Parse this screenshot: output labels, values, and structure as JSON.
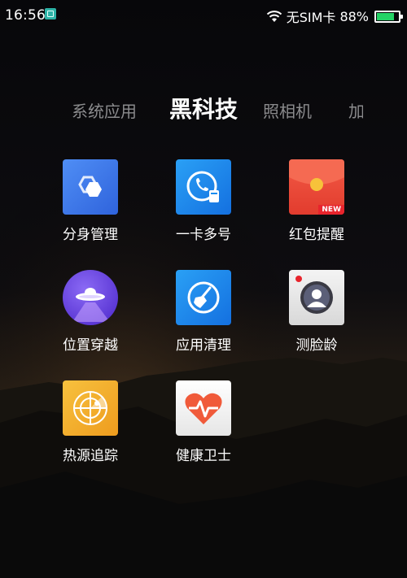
{
  "status_bar": {
    "time": "16:56",
    "carrier": "无SIM卡",
    "battery_percent": "88%",
    "battery_level": 0.88
  },
  "tabs": [
    {
      "label": "系统应用",
      "active": false
    },
    {
      "label": "黑科技",
      "active": true
    },
    {
      "label": "照相机",
      "active": false
    },
    {
      "label": "加",
      "active": false
    }
  ],
  "apps": [
    {
      "label": "分身管理",
      "icon": "clone-app-icon",
      "color": "#3b7cf0"
    },
    {
      "label": "一卡多号",
      "icon": "multi-number-icon",
      "color": "#1a8cf0"
    },
    {
      "label": "红包提醒",
      "icon": "red-envelope-icon",
      "color": "#ee4433",
      "badge": "NEW"
    },
    {
      "label": "位置穿越",
      "icon": "ufo-icon",
      "color": "#6b3fe0"
    },
    {
      "label": "应用清理",
      "icon": "broom-icon",
      "color": "#1e88f0"
    },
    {
      "label": "测脸龄",
      "icon": "face-age-icon",
      "color": "#e8e8e8"
    },
    {
      "label": "热源追踪",
      "icon": "radar-icon",
      "color": "#f3b02a"
    },
    {
      "label": "健康卫士",
      "icon": "heart-guard-icon",
      "color": "#f2f2f2"
    }
  ]
}
